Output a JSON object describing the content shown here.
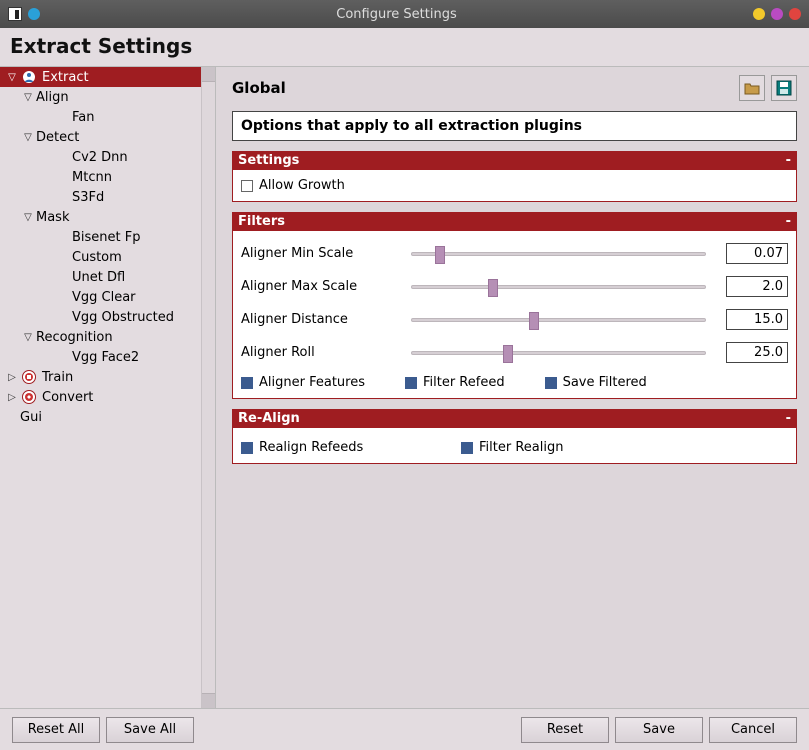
{
  "window": {
    "title": "Configure Settings"
  },
  "header": {
    "title": "Extract Settings"
  },
  "colors": {
    "titlebar_dot_left": "#2aa0d8",
    "titlebar_dot_r1": "#f3c92b",
    "titlebar_dot_r2": "#b94bc2",
    "titlebar_dot_r3": "#e1443f",
    "accent": "#9f1d21"
  },
  "tree": {
    "items": [
      {
        "label": "Extract",
        "level": 0,
        "expanded": true,
        "icon": "person-icon",
        "top": true
      },
      {
        "label": "Align",
        "level": 1,
        "expanded": true
      },
      {
        "label": "Fan",
        "level": 2
      },
      {
        "label": "Detect",
        "level": 1,
        "expanded": true
      },
      {
        "label": "Cv2 Dnn",
        "level": 2
      },
      {
        "label": "Mtcnn",
        "level": 2
      },
      {
        "label": "S3Fd",
        "level": 2
      },
      {
        "label": "Mask",
        "level": 1,
        "expanded": true
      },
      {
        "label": "Bisenet Fp",
        "level": 2
      },
      {
        "label": "Custom",
        "level": 2
      },
      {
        "label": "Unet Dfl",
        "level": 2
      },
      {
        "label": "Vgg Clear",
        "level": 2
      },
      {
        "label": "Vgg Obstructed",
        "level": 2
      },
      {
        "label": "Recognition",
        "level": 1,
        "expanded": true
      },
      {
        "label": "Vgg Face2",
        "level": 2
      },
      {
        "label": "Train",
        "level": 0,
        "expanded": false,
        "icon": "train-icon"
      },
      {
        "label": "Convert",
        "level": 0,
        "expanded": false,
        "icon": "convert-icon"
      },
      {
        "label": "Gui",
        "level": 0,
        "expanded": null
      }
    ]
  },
  "content": {
    "title": "Global",
    "description": "Options that apply to all extraction plugins",
    "icons": {
      "open": "folder-open-icon",
      "save": "floppy-save-icon"
    },
    "sections": {
      "settings": {
        "title": "Settings",
        "allow_growth": {
          "label": "Allow Growth",
          "checked": false
        }
      },
      "filters": {
        "title": "Filters",
        "sliders": [
          {
            "label": "Aligner Min Scale",
            "value": "0.07",
            "pos": 8
          },
          {
            "label": "Aligner Max Scale",
            "value": "2.0",
            "pos": 26
          },
          {
            "label": "Aligner Distance",
            "value": "15.0",
            "pos": 40
          },
          {
            "label": "Aligner Roll",
            "value": "25.0",
            "pos": 31
          }
        ],
        "checks": [
          {
            "label": "Aligner Features",
            "checked": true
          },
          {
            "label": "Filter Refeed",
            "checked": true
          },
          {
            "label": "Save Filtered",
            "checked": true
          }
        ]
      },
      "realign": {
        "title": "Re-Align",
        "checks": [
          {
            "label": "Realign Refeeds",
            "checked": true
          },
          {
            "label": "Filter Realign",
            "checked": true
          }
        ]
      }
    }
  },
  "footer": {
    "reset_all": "Reset All",
    "save_all": "Save All",
    "reset": "Reset",
    "save": "Save",
    "cancel": "Cancel"
  }
}
